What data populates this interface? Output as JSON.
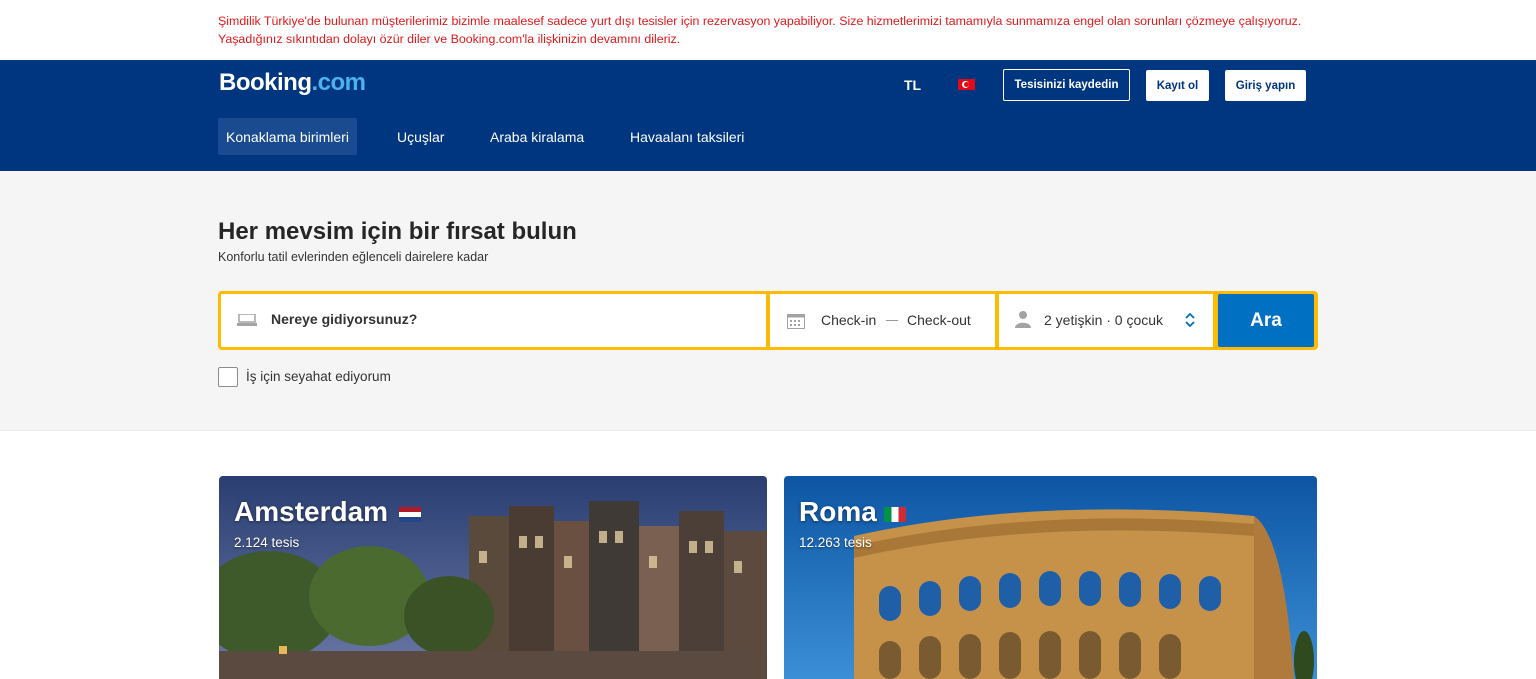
{
  "notice": "Şimdilik Türkiye'de bulunan müşterilerimiz bizimle maalesef sadece yurt dışı tesisler için rezervasyon yapabiliyor. Size hizmetlerimizi tamamıyla sunmamıza engel olan sorunları çözmeye çalışıyoruz. Yaşadığınız sıkıntıdan dolayı özür diler ve Booking.com'la ilişkinizin devamını dileriz.",
  "header": {
    "logo_main": "Booking",
    "logo_dot": ".com",
    "currency": "TL",
    "list_property": "Tesisinizi kaydedin",
    "register": "Kayıt ol",
    "sign_in": "Giriş yapın"
  },
  "nav": [
    {
      "label": "Konaklama birimleri",
      "active": true
    },
    {
      "label": "Uçuşlar"
    },
    {
      "label": "Araba kiralama"
    },
    {
      "label": "Havaalanı taksileri"
    }
  ],
  "hero": {
    "title": "Her mevsim için bir fırsat bulun",
    "subtitle": "Konforlu tatil evlerinden eğlenceli dairelere kadar"
  },
  "search": {
    "destination_placeholder": "Nereye gidiyorsunuz?",
    "checkin": "Check-in",
    "checkout": "Check-out",
    "guests": "2 yetişkin · 0 çocuk",
    "button": "Ara"
  },
  "business_trip": "İş için seyahat ediyorum",
  "destinations": [
    {
      "city": "Amsterdam",
      "count": "2.124 tesis",
      "flag": "netherlands-flag"
    },
    {
      "city": "Roma",
      "count": "12.263 tesis",
      "flag": "italy-flag"
    }
  ],
  "colors": {
    "brand_blue": "#003580",
    "search_yellow": "#febb02",
    "button_blue": "#0071c2",
    "notice_red": "#e0181b"
  }
}
